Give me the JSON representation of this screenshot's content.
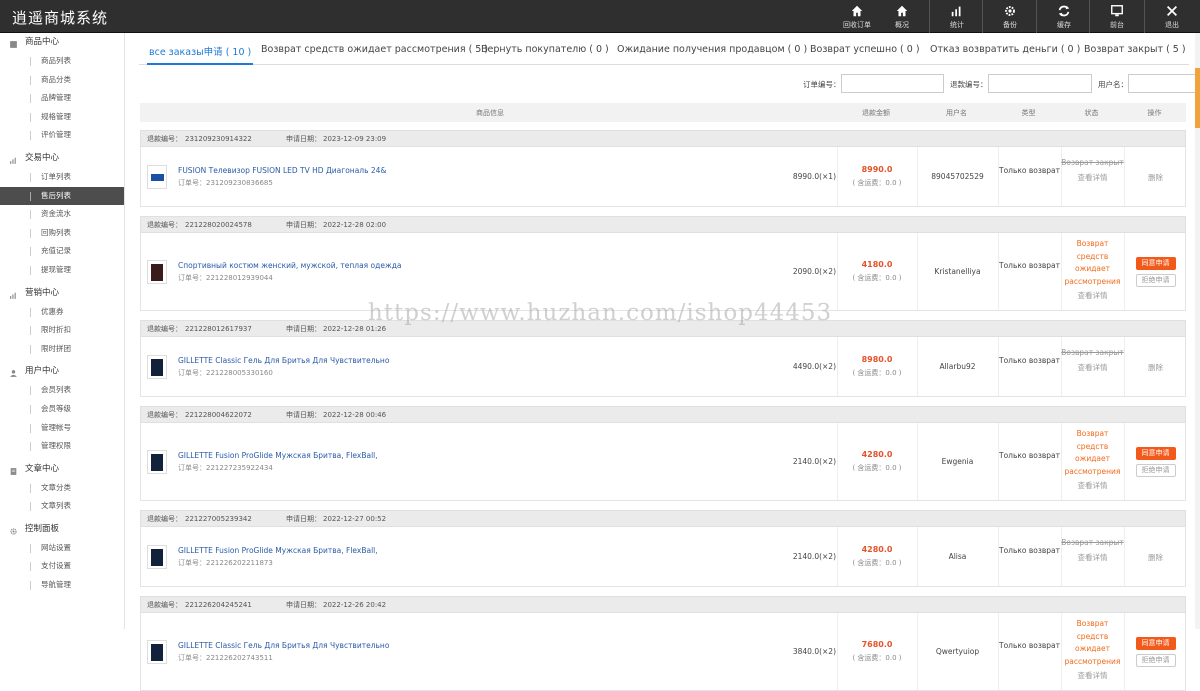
{
  "app": {
    "title": "逍遥商城系统"
  },
  "topbar": [
    {
      "label": "回收订单",
      "icon": "home-icon"
    },
    {
      "label": "概况",
      "icon": "home-icon"
    },
    {
      "label": "统计",
      "icon": "bar-chart-icon"
    },
    {
      "label": "备份",
      "icon": "gear-icon"
    },
    {
      "label": "缓存",
      "icon": "refresh-icon"
    },
    {
      "label": "前台",
      "icon": "monitor-icon"
    },
    {
      "label": "退出",
      "icon": "close-icon"
    }
  ],
  "sidebar": [
    {
      "group": "商品中心",
      "icon": "grid-icon",
      "items": [
        "商品列表",
        "商品分类",
        "品牌管理",
        "规格管理",
        "评价管理"
      ]
    },
    {
      "group": "交易中心",
      "icon": "bar-chart-icon",
      "items": [
        "订单列表",
        "售后列表",
        "资金流水",
        "回购列表",
        "充值记录",
        "提现管理"
      ]
    },
    {
      "group": "营销中心",
      "icon": "bar-chart-icon",
      "items": [
        "优惠券",
        "限时折扣",
        "限时拼团"
      ]
    },
    {
      "group": "用户中心",
      "icon": "user-icon",
      "items": [
        "会员列表",
        "会员等级",
        "管理帐号",
        "管理权限"
      ]
    },
    {
      "group": "文章中心",
      "icon": "document-icon",
      "items": [
        "文章分类",
        "文章列表"
      ]
    },
    {
      "group": "控制面板",
      "icon": "gear-icon",
      "items": [
        "网站设置",
        "支付设置",
        "导航管理"
      ]
    }
  ],
  "sidebar_active": "售后列表",
  "tabs": [
    "все заказы申请 ( 10 )",
    "Возврат средств ожидает рассмотрения ( 5 )",
    "Вернуть покупателю ( 0 )",
    "Ожидание получения продавцом ( 0 )",
    "Возврат успешно ( 0 )",
    "Отказ возвратить деньги ( 0 )",
    "Возврат закрыт ( 5 )"
  ],
  "filters": {
    "order_no_label": "订单编号：",
    "refund_no_label": "退款编号：",
    "username_label": "用户名：",
    "search_label": "search"
  },
  "table_headers": [
    "商品信息",
    "退款金额",
    "用户名",
    "类型",
    "状态",
    "操作"
  ],
  "labels": {
    "refund_no": "退款编号：",
    "apply_date": "申请日期：",
    "order_no": "订单号：",
    "shipping_incl": "( 含运费：0.0 )",
    "type": "Только возврат",
    "view_detail": "查看详情",
    "delete": "删除",
    "agree": "同意申请",
    "reject": "拒绝申请",
    "status_closed": "Возврат закрыт",
    "status_pending": "Возврат средств ожидает рассмотрения"
  },
  "orders": [
    {
      "refund_no": "231209230914322",
      "date": "2023-12-09 23:09",
      "product": "FUSION Телевизор FUSION LED TV HD Диагональ 24&",
      "order_no": "231209230836685",
      "price": "8990.0(×1)",
      "amount": "8990.0",
      "user": "89045702529",
      "status": "closed"
    },
    {
      "refund_no": "221228020024578",
      "date": "2022-12-28 02:00",
      "product": "Спортивный костюм женский, мужской, теплая одежда",
      "order_no": "221228012939044",
      "price": "2090.0(×2)",
      "amount": "4180.0",
      "user": "Kristanelliya",
      "status": "pending"
    },
    {
      "refund_no": "221228012617937",
      "date": "2022-12-28 01:26",
      "product": "GILLETTE Classic Гель Для Бритья Для Чувствительно",
      "order_no": "221228005330160",
      "price": "4490.0(×2)",
      "amount": "8980.0",
      "user": "Allarbu92",
      "status": "closed"
    },
    {
      "refund_no": "221228004622072",
      "date": "2022-12-28 00:46",
      "product": "GILLETTE Fusion ProGlide Мужская Бритва, FlexBall,",
      "order_no": "221227235922434",
      "price": "2140.0(×2)",
      "amount": "4280.0",
      "user": "Ewgenia",
      "status": "pending"
    },
    {
      "refund_no": "221227005239342",
      "date": "2022-12-27 00:52",
      "product": "GILLETTE Fusion ProGlide Мужская Бритва, FlexBall,",
      "order_no": "221226202211873",
      "price": "2140.0(×2)",
      "amount": "4280.0",
      "user": "Alisa",
      "status": "closed"
    },
    {
      "refund_no": "221226204245241",
      "date": "2022-12-26 20:42",
      "product": "GILLETTE Classic Гель Для Бритья Для Чувствительно",
      "order_no": "221226202743511",
      "price": "3840.0(×2)",
      "amount": "7680.0",
      "user": "Qwertyuiop",
      "status": "pending"
    }
  ],
  "watermark": "https://www.huzhan.com/ishop44453"
}
